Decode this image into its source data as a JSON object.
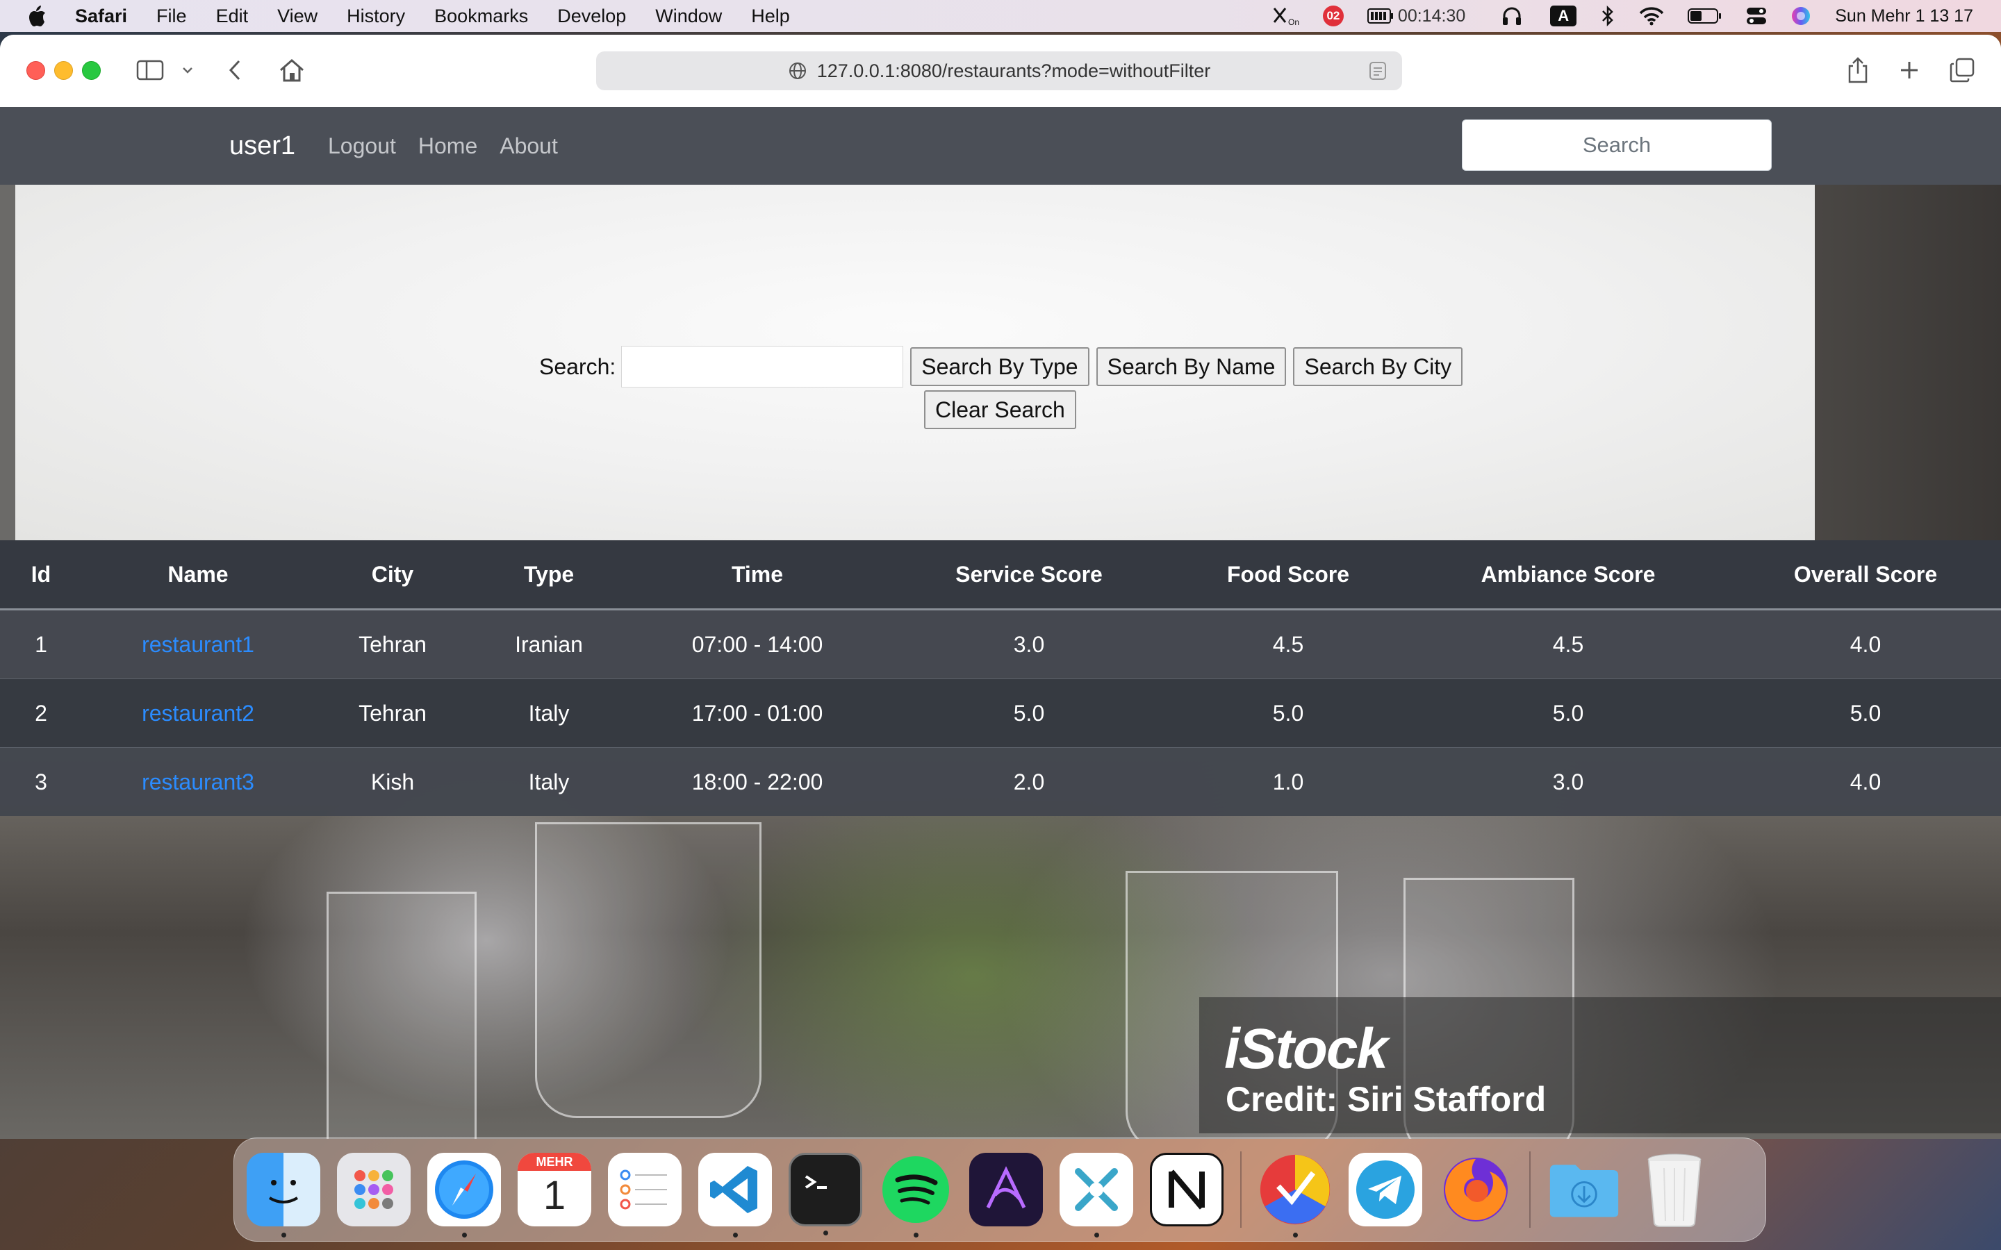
{
  "menubar": {
    "items": [
      "Safari",
      "File",
      "Edit",
      "View",
      "History",
      "Bookmarks",
      "Develop",
      "Window",
      "Help"
    ],
    "status": {
      "notification_count": "02",
      "battery_timer": "00:14:30",
      "input_source": "A",
      "datetime": "Sun Mehr 1  13 17"
    }
  },
  "browser": {
    "url": "127.0.0.1:8080/restaurants?mode=withoutFilter"
  },
  "navbar": {
    "brand": "user1",
    "links": [
      "Logout",
      "Home",
      "About"
    ],
    "search_placeholder": "Search"
  },
  "search_form": {
    "label": "Search:",
    "input_value": "",
    "buttons": [
      "Search By Type",
      "Search By Name",
      "Search By City"
    ],
    "clear_label": "Clear Search"
  },
  "table": {
    "headers": [
      "Id",
      "Name",
      "City",
      "Type",
      "Time",
      "Service Score",
      "Food Score",
      "Ambiance Score",
      "Overall Score"
    ],
    "rows": [
      [
        "1",
        "restaurant1",
        "Tehran",
        "Iranian",
        "07:00 - 14:00",
        "3.0",
        "4.5",
        "4.5",
        "4.0"
      ],
      [
        "2",
        "restaurant2",
        "Tehran",
        "Italy",
        "17:00 - 01:00",
        "5.0",
        "5.0",
        "5.0",
        "5.0"
      ],
      [
        "3",
        "restaurant3",
        "Kish",
        "Italy",
        "18:00 - 22:00",
        "2.0",
        "1.0",
        "3.0",
        "4.0"
      ]
    ]
  },
  "watermark": {
    "logo": "iStock",
    "credit": "Credit: Siri Stafford"
  },
  "dock": {
    "calendar_month": "MEHR",
    "calendar_day": "1",
    "apps": [
      "finder-icon",
      "launchpad-icon",
      "safari-icon",
      "calendar-icon",
      "reminders-icon",
      "vscode-icon",
      "terminal-icon",
      "spotify-icon",
      "affinity-icon",
      "xcode-tool-icon",
      "notion-icon",
      "taskheat-icon",
      "telegram-icon",
      "firefox-icon",
      "downloads-icon",
      "trash-icon"
    ]
  }
}
